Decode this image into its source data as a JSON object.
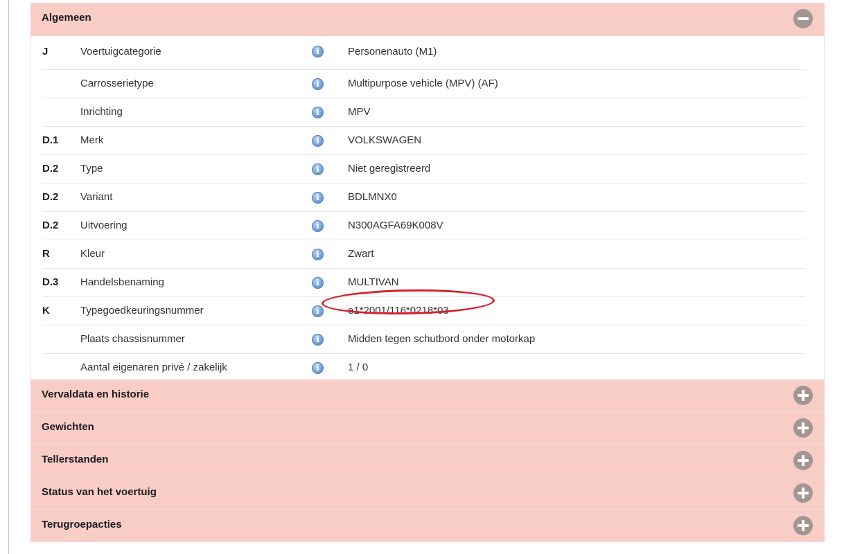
{
  "colors": {
    "header_bg": "#f7cdc6",
    "toggle_bg": "#a39591",
    "info_icon": "#6f9fd6",
    "highlight": "#d8202a"
  },
  "sections": {
    "algemeen": {
      "title": "Algemeen",
      "state": "expanded",
      "icon": "minus-circle-icon"
    },
    "vervaldata": {
      "title": "Vervaldata en historie",
      "state": "collapsed",
      "icon": "plus-circle-icon"
    },
    "gewichten": {
      "title": "Gewichten",
      "state": "collapsed",
      "icon": "plus-circle-icon"
    },
    "tellerstanden": {
      "title": "Tellerstanden",
      "state": "collapsed",
      "icon": "plus-circle-icon"
    },
    "status": {
      "title": "Status van het voertuig",
      "state": "collapsed",
      "icon": "plus-circle-icon"
    },
    "terugroepacties": {
      "title": "Terugroepacties",
      "state": "collapsed",
      "icon": "plus-circle-icon"
    }
  },
  "info_icon_glyph": "i",
  "rows": [
    {
      "code": "J",
      "label": "Voertuigcategorie",
      "value": "Personenauto (M1)"
    },
    {
      "code": "",
      "label": "Carrosserietype",
      "value": "Multipurpose vehicle (MPV) (AF)"
    },
    {
      "code": "",
      "label": "Inrichting",
      "value": "MPV"
    },
    {
      "code": "D.1",
      "label": "Merk",
      "value": "VOLKSWAGEN"
    },
    {
      "code": "D.2",
      "label": "Type",
      "value": "Niet geregistreerd"
    },
    {
      "code": "D.2",
      "label": "Variant",
      "value": "BDLMNX0"
    },
    {
      "code": "D.2",
      "label": "Uitvoering",
      "value": "N300AGFA69K008V"
    },
    {
      "code": "R",
      "label": "Kleur",
      "value": "Zwart"
    },
    {
      "code": "D.3",
      "label": "Handelsbenaming",
      "value": "MULTIVAN"
    },
    {
      "code": "K",
      "label": "Typegoedkeuringsnummer",
      "value": "e1*2001/116*0218*03"
    },
    {
      "code": "",
      "label": "Plaats chassisnummer",
      "value": "Midden tegen schutbord onder motorkap"
    },
    {
      "code": "",
      "label": "Aantal eigenaren privé / zakelijk",
      "value": "1 / 0"
    }
  ]
}
